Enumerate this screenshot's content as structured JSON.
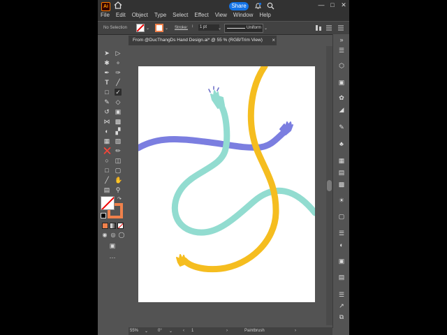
{
  "app": {
    "logo": "Ai",
    "menus": [
      "File",
      "Edit",
      "Object",
      "Type",
      "Select",
      "Effect",
      "View",
      "Window",
      "Help"
    ],
    "share_label": "Share",
    "window_controls": [
      "—",
      "□",
      "✕"
    ]
  },
  "control_bar": {
    "selection_status": "No Selection",
    "stroke_label": "Stroke:",
    "stroke_weight": "1 pt",
    "stroke_profile": "Uniform"
  },
  "document": {
    "tab_title": "From @DucThangDs Hand Design.ai* @ 55 % (RGB/Trim View)",
    "close_symbol": "×"
  },
  "status_bar": {
    "zoom": "55%",
    "rotation": "0°",
    "artboard_index": "1",
    "current_tool": "Paintbrush"
  },
  "artwork": {
    "colors": {
      "purple": "#7b7ee0",
      "mint": "#92dcd0",
      "yellow": "#f5bd1f"
    },
    "shapes": [
      "purple-arm",
      "mint-arm",
      "yellow-arm"
    ]
  },
  "colors": {
    "ui_dark": "#323232",
    "ui_mid": "#535353",
    "accent_blue": "#1473e6",
    "fill_orange": "#f0814b"
  }
}
